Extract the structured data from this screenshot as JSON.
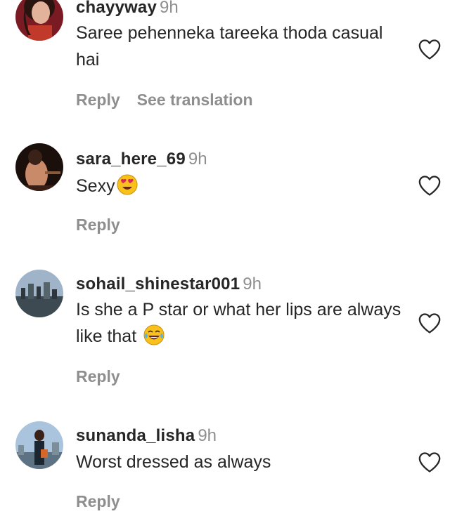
{
  "comments": [
    {
      "username": "chayyway",
      "time": "9h",
      "text": "Saree pehenneka tareeka thoda casual hai",
      "reply_label": "Reply",
      "translate_label": "See translation"
    },
    {
      "username": "sara_here_69",
      "time": "9h",
      "text": "Sexy",
      "emoji": "heart-eyes-emoji",
      "reply_label": "Reply"
    },
    {
      "username": "sohail_shinestar001",
      "time": "9h",
      "text": "Is she a P star or what her lips are always like that",
      "emoji": "tears-of-joy-emoji",
      "reply_label": "Reply"
    },
    {
      "username": "sunanda_lisha",
      "time": "9h",
      "text": "Worst dressed as always",
      "reply_label": "Reply"
    }
  ],
  "icons": {
    "like": "heart-outline-icon"
  },
  "colors": {
    "primary_text": "#262626",
    "secondary_text": "#8e8e8e",
    "emoji_yellow": "#f9c21b",
    "heart_red": "#e0245e"
  }
}
